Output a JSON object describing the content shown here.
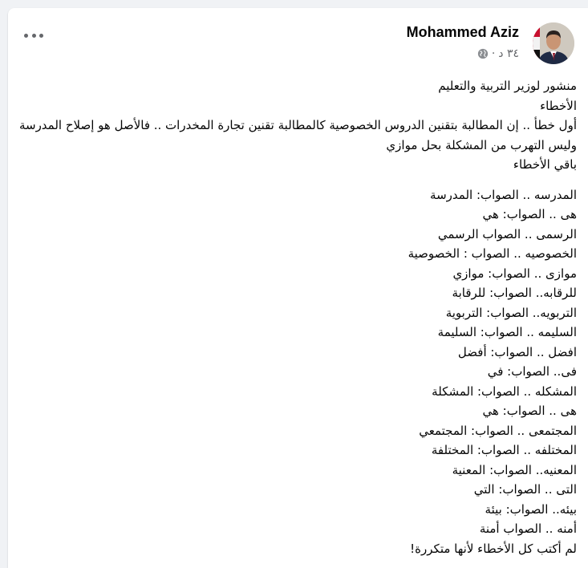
{
  "post": {
    "author": "Mohammed Aziz",
    "timestamp": "٣٤ د",
    "separator": "·",
    "privacy_icon": "globe-icon",
    "menu_icon": "more-options-icon",
    "intro_lines": [
      "منشور لوزير التربية والتعليم",
      "الأخطاء",
      "أول خطأ .. إن المطالبة بتقنين الدروس الخصوصية كالمطالبة تقنين تجارة المخدرات .. فالأصل هو إصلاح المدرسة",
      "وليس التهرب من المشكلة بحل موازي",
      "باقي الأخطاء"
    ],
    "correction_lines": [
      "المدرسه .. الصواب: المدرسة",
      "هى .. الصواب: هي",
      "الرسمى .. الصواب الرسمي",
      "الخصوصيه .. الصواب : الخصوصية",
      "موازى .. الصواب: موازي",
      "للرقابه.. الصواب: للرقابة",
      "التربويه.. الصواب: التربوية",
      "السليمه .. الصواب: السليمة",
      "افضل .. الصواب: أفضل",
      "فى.. الصواب: في",
      "المشكله .. الصواب: المشكلة",
      "هى .. الصواب: هي",
      "المجتمعى .. الصواب: المجتمعي",
      "المختلفه .. الصواب: المختلفة",
      "المعنيه.. الصواب: المعنية",
      "التى .. الصواب: التي",
      "بيئه.. الصواب: بيئة",
      "أمنه .. الصواب أمنة",
      "لم أكتب كل الأخطاء لأنها متكررة!"
    ]
  },
  "colors": {
    "background": "#f0f2f5",
    "card": "#ffffff",
    "text": "#050505",
    "secondary_text": "#65676b"
  }
}
